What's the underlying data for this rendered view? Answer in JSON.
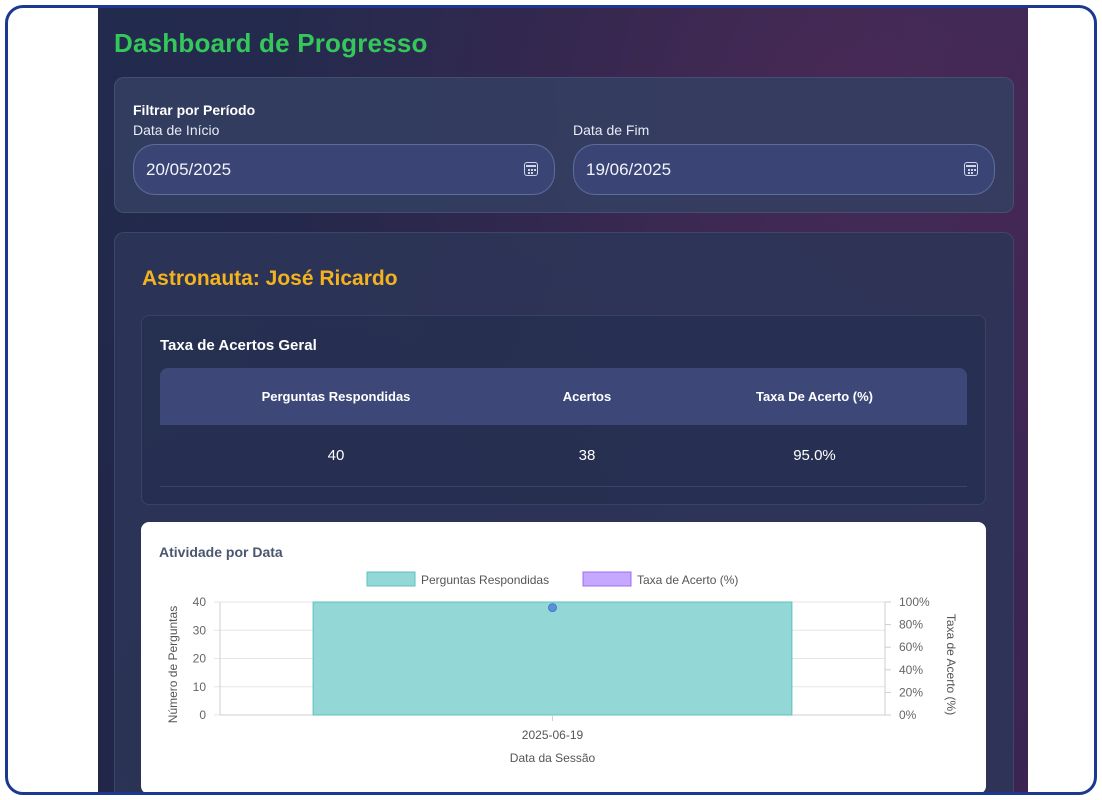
{
  "page": {
    "title": "Dashboard de Progresso"
  },
  "filter": {
    "title": "Filtrar por Período",
    "start_label": "Data de Início",
    "start_value": "20/05/2025",
    "end_label": "Data de Fim",
    "end_value": "19/06/2025",
    "icon": "calendar-icon"
  },
  "astronaut": {
    "label": "Astronauta: José Ricardo"
  },
  "rate_table": {
    "title": "Taxa de Acertos Geral",
    "headers": [
      "Perguntas Respondidas",
      "Acertos",
      "Taxa De Acerto (%)"
    ],
    "rows": [
      [
        "40",
        "38",
        "95.0%"
      ]
    ]
  },
  "chart_section": {
    "title": "Atividade por Data"
  },
  "colors": {
    "title_green": "#34c759",
    "astronaut_yellow": "#f5b21f",
    "bar_fill": "#93d8d6",
    "bar_stroke": "#5cc1bd",
    "rate_fill": "#c5a8ff",
    "rate_stroke": "#9b6cf5",
    "point": "#5b8fd9"
  },
  "chart_data": {
    "type": "bar",
    "categories": [
      "2025-06-19"
    ],
    "series": [
      {
        "name": "Perguntas Respondidas",
        "type": "bar",
        "axis": "left",
        "values": [
          40
        ]
      },
      {
        "name": "Taxa de Acerto (%)",
        "type": "line",
        "axis": "right",
        "values": [
          95.0
        ]
      }
    ],
    "xlabel": "Data da Sessão",
    "ylabel": "Número de Perguntas",
    "y2label": "Taxa de Acerto (%)",
    "ylim": [
      0,
      40
    ],
    "y2lim": [
      0,
      100
    ],
    "yticks": [
      "0",
      "10",
      "20",
      "30",
      "40"
    ],
    "y2ticks": [
      "0%",
      "20%",
      "40%",
      "60%",
      "80%",
      "100%"
    ],
    "legend_position": "top-center",
    "grid": true
  }
}
